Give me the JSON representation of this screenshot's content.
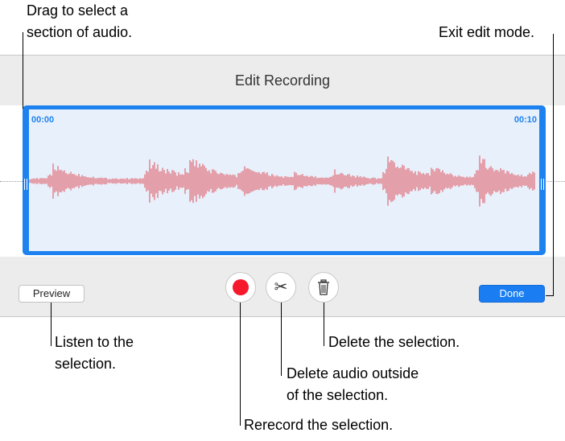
{
  "window": {
    "title": "Edit Recording",
    "time_start": "00:00",
    "time_end": "00:10",
    "preview_label": "Preview",
    "done_label": "Done"
  },
  "callouts": {
    "drag": [
      "Drag to select a",
      "section of audio."
    ],
    "exit": "Exit edit mode.",
    "listen": [
      "Listen to the",
      "selection."
    ],
    "delete_selection": "Delete the selection.",
    "trim": [
      "Delete audio outside",
      "of the selection."
    ],
    "rerecord": "Rerecord the selection."
  },
  "icons": {
    "record": "record-icon",
    "trim": "scissors-icon",
    "delete": "trash-icon"
  },
  "colors": {
    "accent": "#1d82f0",
    "waveform": "#e0505a",
    "record": "#f6192c",
    "selection_bg": "#e8f0fb"
  }
}
